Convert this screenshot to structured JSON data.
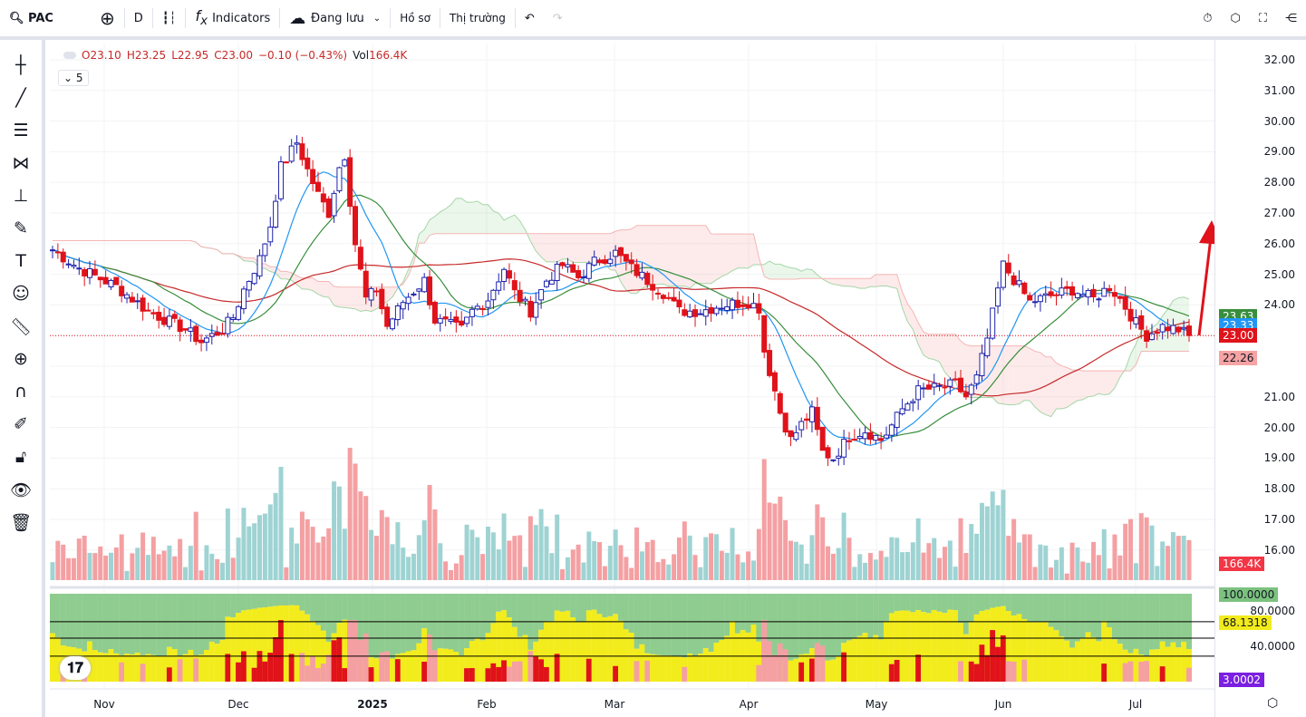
{
  "toolbar": {
    "symbol": "PAC",
    "interval": "D",
    "indicators": "Indicators",
    "save": "Đang lưu",
    "profile": "Hồ sơ",
    "market": "Thị trường"
  },
  "legend": {
    "open": "O23.10",
    "high": "H23.25",
    "low": "L22.95",
    "close": "C23.00",
    "change": "−0.10 (−0.43%)",
    "vol_label": "Vol",
    "vol": "166.4K",
    "indicators_count": "5"
  },
  "price_axis": [
    "32.00",
    "31.00",
    "30.00",
    "29.00",
    "28.00",
    "27.00",
    "26.00",
    "25.00",
    "24.00",
    "21.00",
    "20.00",
    "19.00",
    "18.00",
    "17.00",
    "16.00"
  ],
  "badges": {
    "ma_green": "23.63",
    "ma_blue": "23.33",
    "last": "23.00",
    "ma_red": "22.26",
    "volume": "166.4K",
    "osc_top": "100.0000",
    "osc_yellow": "68.1318",
    "osc_purple": "3.0002"
  },
  "osc_axis": [
    "80.0000",
    "40.0000"
  ],
  "months": [
    "Nov",
    "Dec",
    "2025",
    "Feb",
    "Mar",
    "Apr",
    "May",
    "Jun",
    "Jul"
  ],
  "colors": {
    "up": "#1e22aa",
    "down": "#e0121a",
    "green": "#388e3c",
    "blue": "#2196f3",
    "red": "#c62828"
  },
  "chart_data": {
    "type": "candlestick",
    "bars": 180,
    "close_keypoints": [
      [
        0,
        25.8
      ],
      [
        5,
        25.2
      ],
      [
        12,
        24.6
      ],
      [
        18,
        23.8
      ],
      [
        25,
        23.2
      ],
      [
        28,
        22.8
      ],
      [
        32,
        23.2
      ],
      [
        34,
        23.6
      ],
      [
        36,
        24.5
      ],
      [
        39,
        25.5
      ],
      [
        41,
        26.6
      ],
      [
        43,
        28.5
      ],
      [
        46,
        29.3
      ],
      [
        48,
        28.4
      ],
      [
        50,
        27.6
      ],
      [
        52,
        27.0
      ],
      [
        54,
        28.5
      ],
      [
        55,
        28.9
      ],
      [
        56,
        27.4
      ],
      [
        57,
        26
      ],
      [
        59,
        24.2
      ],
      [
        61,
        24.5
      ],
      [
        63,
        23.3
      ],
      [
        66,
        24.1
      ],
      [
        70,
        24.8
      ],
      [
        72,
        23.5
      ],
      [
        74,
        23.4
      ],
      [
        77,
        23.2
      ],
      [
        79,
        23.8
      ],
      [
        82,
        24.2
      ],
      [
        85,
        25.2
      ],
      [
        87,
        24.4
      ],
      [
        90,
        23.8
      ],
      [
        93,
        24.8
      ],
      [
        96,
        25.3
      ],
      [
        99,
        24.9
      ],
      [
        102,
        25.4
      ],
      [
        106,
        25.7
      ],
      [
        109,
        25.2
      ],
      [
        112,
        24.8
      ],
      [
        115,
        24.4
      ],
      [
        118,
        23.8
      ],
      [
        122,
        23.8
      ],
      [
        126,
        24.0
      ],
      [
        131,
        24.1
      ],
      [
        133,
        23.9
      ],
      [
        134,
        22.5
      ],
      [
        136,
        21.2
      ],
      [
        137,
        20.5
      ],
      [
        139,
        19.6
      ],
      [
        141,
        20.1
      ],
      [
        143,
        20.5
      ],
      [
        145,
        19.2
      ],
      [
        147,
        19.0
      ],
      [
        150,
        19.7
      ],
      [
        153,
        19.9
      ],
      [
        156,
        19.6
      ],
      [
        157,
        19.8
      ],
      [
        160,
        20.6
      ],
      [
        163,
        21.2
      ],
      [
        167,
        21.3
      ],
      [
        170,
        21.4
      ],
      [
        172,
        21.0
      ],
      [
        174,
        21.6
      ],
      [
        176,
        22.9
      ]
    ],
    "note": "series continues through Jul; last close 23.00"
  }
}
